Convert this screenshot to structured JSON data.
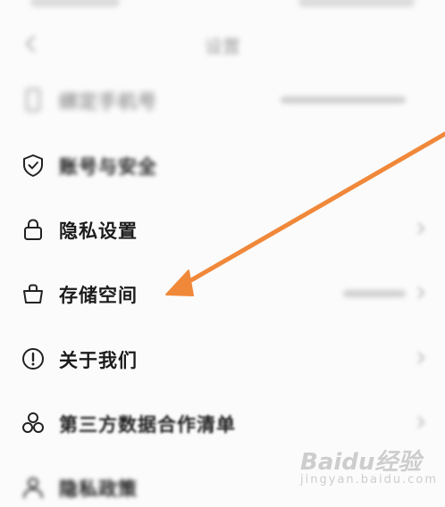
{
  "title_bar": {
    "title": "设置"
  },
  "settings": {
    "items": [
      {
        "label": "绑定手机号",
        "icon": "phone-icon",
        "blurred": true
      },
      {
        "label": "账号与安全",
        "icon": "shield-icon",
        "blurred": false
      },
      {
        "label": "隐私设置",
        "icon": "lock-icon",
        "blurred": false
      },
      {
        "label": "存储空间",
        "icon": "storage-icon",
        "blurred": false
      },
      {
        "label": "关于我们",
        "icon": "info-icon",
        "blurred": false
      },
      {
        "label": "第三方数据合作清单",
        "icon": "share-nodes-icon",
        "blurred": false
      },
      {
        "label": "隐私政策",
        "icon": "user-icon",
        "blurred": true
      }
    ]
  },
  "annotation": {
    "arrow_color": "#f0883a",
    "points_to": "存储空间"
  },
  "watermark": {
    "text": "Baidu经验",
    "subtext": "jingyan.baidu.com"
  }
}
